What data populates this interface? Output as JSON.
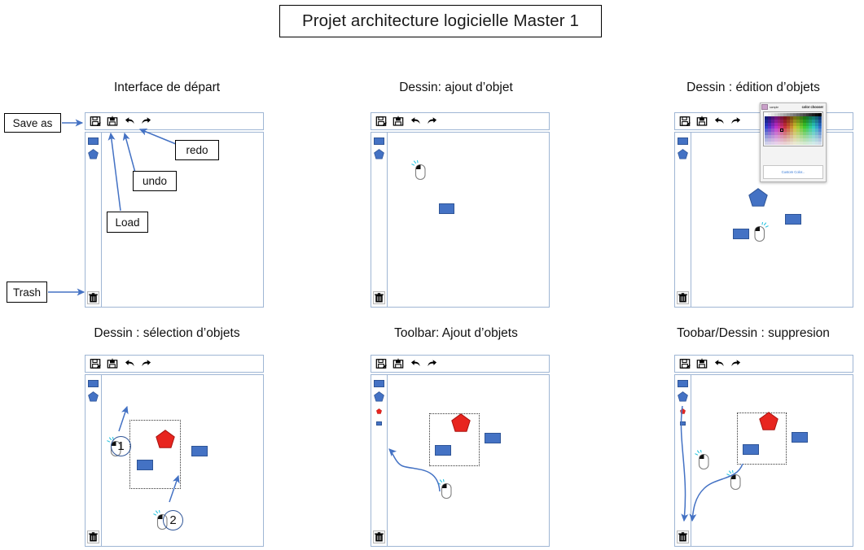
{
  "document": {
    "title": "Projet architecture logicielle Master 1"
  },
  "toolbar_icons": [
    {
      "name": "save-as-icon",
      "label": "Save as"
    },
    {
      "name": "load-icon",
      "label": "Load"
    },
    {
      "name": "undo-icon",
      "label": "undo"
    },
    {
      "name": "redo-icon",
      "label": "redo"
    }
  ],
  "annotations": {
    "save_as": "Save as",
    "load": "Load",
    "undo": "undo",
    "redo": "redo",
    "trash": "Trash",
    "marker_one": "1",
    "marker_two": "2"
  },
  "colors": {
    "shape_blue": "#4472c4",
    "shape_blue_border": "#2f5597",
    "shape_red": "#e8251f",
    "shape_red_border": "#a81410",
    "arrow_blue": "#4472c4",
    "panel_border": "#9fb6d4",
    "click_spark": "#2ec5e0",
    "custom_color_link": "#3b7dd8"
  },
  "panels": [
    {
      "id": "panel-start",
      "title": "Interface de départ",
      "shapes_palette": [
        "rectangle",
        "pentagon"
      ],
      "canvas_objects": []
    },
    {
      "id": "panel-add-object",
      "title": "Dessin: ajout d’objet",
      "shapes_palette": [
        "rectangle",
        "pentagon"
      ],
      "canvas_objects": [
        {
          "type": "rectangle",
          "color": "#4472c4"
        }
      ],
      "cursors": 1
    },
    {
      "id": "panel-edit-objects",
      "title": "Dessin : édition d’objets",
      "shapes_palette": [
        "rectangle",
        "pentagon"
      ],
      "canvas_objects": [
        {
          "type": "pentagon",
          "color": "#4472c4"
        },
        {
          "type": "rectangle",
          "color": "#4472c4"
        },
        {
          "type": "rectangle",
          "color": "#4472c4"
        }
      ],
      "cursors": 1,
      "popup": "color-chooser"
    },
    {
      "id": "panel-select-objects",
      "title": "Dessin : sélection d’objets",
      "shapes_palette": [
        "rectangle",
        "pentagon"
      ],
      "canvas_objects": [
        {
          "type": "pentagon",
          "color": "#e8251f"
        },
        {
          "type": "rectangle",
          "color": "#4472c4"
        },
        {
          "type": "rectangle",
          "color": "#4472c4"
        }
      ],
      "selection_box": true,
      "cursors": 2,
      "markers": [
        "1",
        "2"
      ]
    },
    {
      "id": "panel-toolbar-add",
      "title": "Toolbar: Ajout d’objets",
      "shapes_palette": [
        "rectangle",
        "pentagon",
        "pentagon-small-red",
        "rectangle-small-blue"
      ],
      "canvas_objects": [
        {
          "type": "pentagon",
          "color": "#e8251f"
        },
        {
          "type": "rectangle",
          "color": "#4472c4"
        },
        {
          "type": "rectangle",
          "color": "#4472c4"
        }
      ],
      "selection_box": true,
      "cursors": 1
    },
    {
      "id": "panel-delete",
      "title": "Toobar/Dessin : suppresion",
      "shapes_palette": [
        "rectangle",
        "pentagon",
        "pentagon-small-red",
        "rectangle-small-blue"
      ],
      "canvas_objects": [
        {
          "type": "pentagon",
          "color": "#e8251f"
        },
        {
          "type": "rectangle",
          "color": "#4472c4"
        },
        {
          "type": "rectangle",
          "color": "#4472c4"
        }
      ],
      "selection_box": true,
      "cursors": 2
    }
  ],
  "color_chooser": {
    "window_label": "color chooser",
    "title_chip_label": "sample",
    "custom_color_label": "Custom Color..."
  }
}
